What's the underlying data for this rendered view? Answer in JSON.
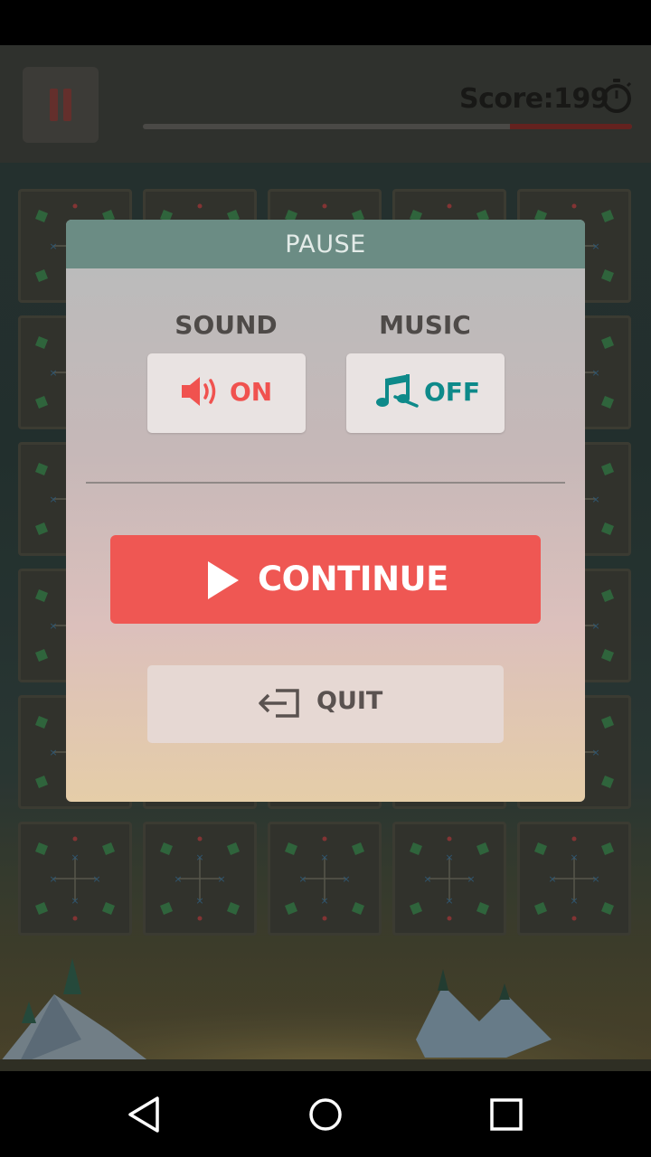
{
  "hud": {
    "score_label": "Score:199",
    "time_remaining_fraction": 0.25
  },
  "pause_dialog": {
    "title": "PAUSE",
    "sound": {
      "label": "SOUND",
      "state": "ON",
      "icon": "speaker-icon",
      "color": "#f0524f"
    },
    "music": {
      "label": "MUSIC",
      "state": "OFF",
      "icon": "music-notes-icon",
      "color": "#0e8a8a"
    },
    "continue_label": "CONTINUE",
    "quit_label": "QUIT"
  },
  "colors": {
    "header": "#6b8c84",
    "continue_button": "#ef5753",
    "quit_button": "#e6d8d3"
  },
  "navigation": {
    "back": "back-icon",
    "home": "home-icon",
    "recents": "recents-icon"
  }
}
